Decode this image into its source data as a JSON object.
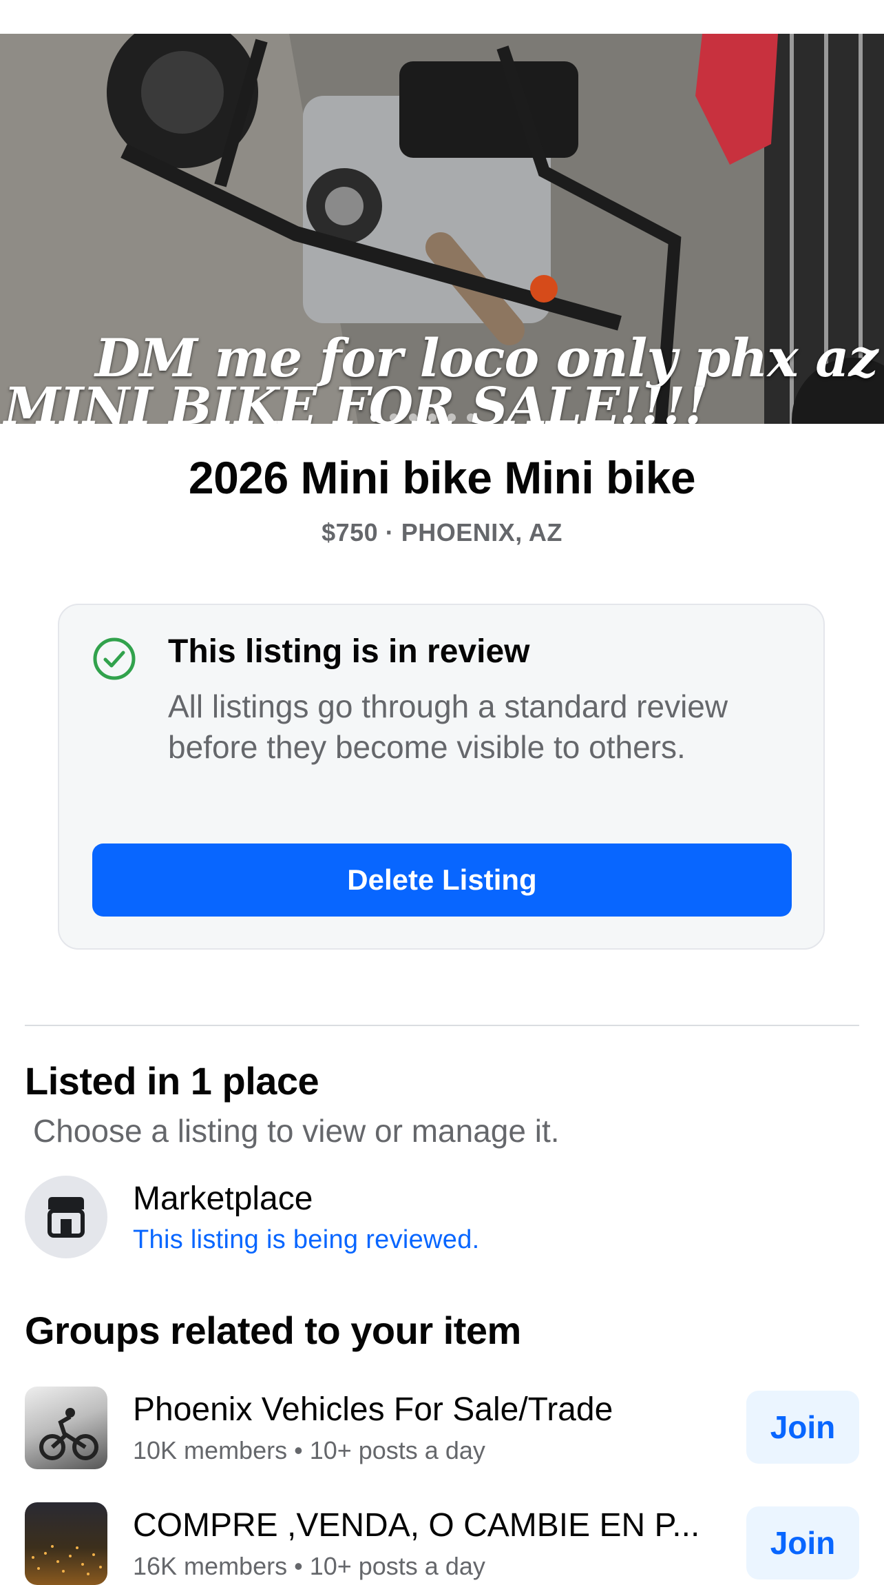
{
  "hero": {
    "overlay_line1": "DM me for loco only phx az",
    "overlay_line2": "MINI BIKE FOR SALE!!!!",
    "photo_count": 6,
    "active_photo": 1
  },
  "listing": {
    "title": "2026 Mini bike Mini bike",
    "subtitle": "$750 · PHOENIX, AZ"
  },
  "review_card": {
    "icon": "check-circle-icon",
    "title": "This listing is in review",
    "body": "All listings go through a standard review before they become visible to others.",
    "delete_label": "Delete Listing",
    "accent": "#0866ff",
    "check_color": "#31a24c"
  },
  "listed_in": {
    "title": "Listed in 1 place",
    "subtitle": "Choose a listing to view or manage it.",
    "items": [
      {
        "icon": "storefront-icon",
        "name": "Marketplace",
        "status": "This listing is being reviewed."
      }
    ]
  },
  "groups": {
    "title": "Groups related to your item",
    "items": [
      {
        "name": "Phoenix Vehicles For Sale/Trade",
        "meta": "10K members • 10+ posts a day",
        "join_label": "Join"
      },
      {
        "name": "COMPRE ,VENDA, O CAMBIE EN P...",
        "meta": "16K members • 10+ posts a day",
        "join_label": "Join"
      }
    ]
  }
}
